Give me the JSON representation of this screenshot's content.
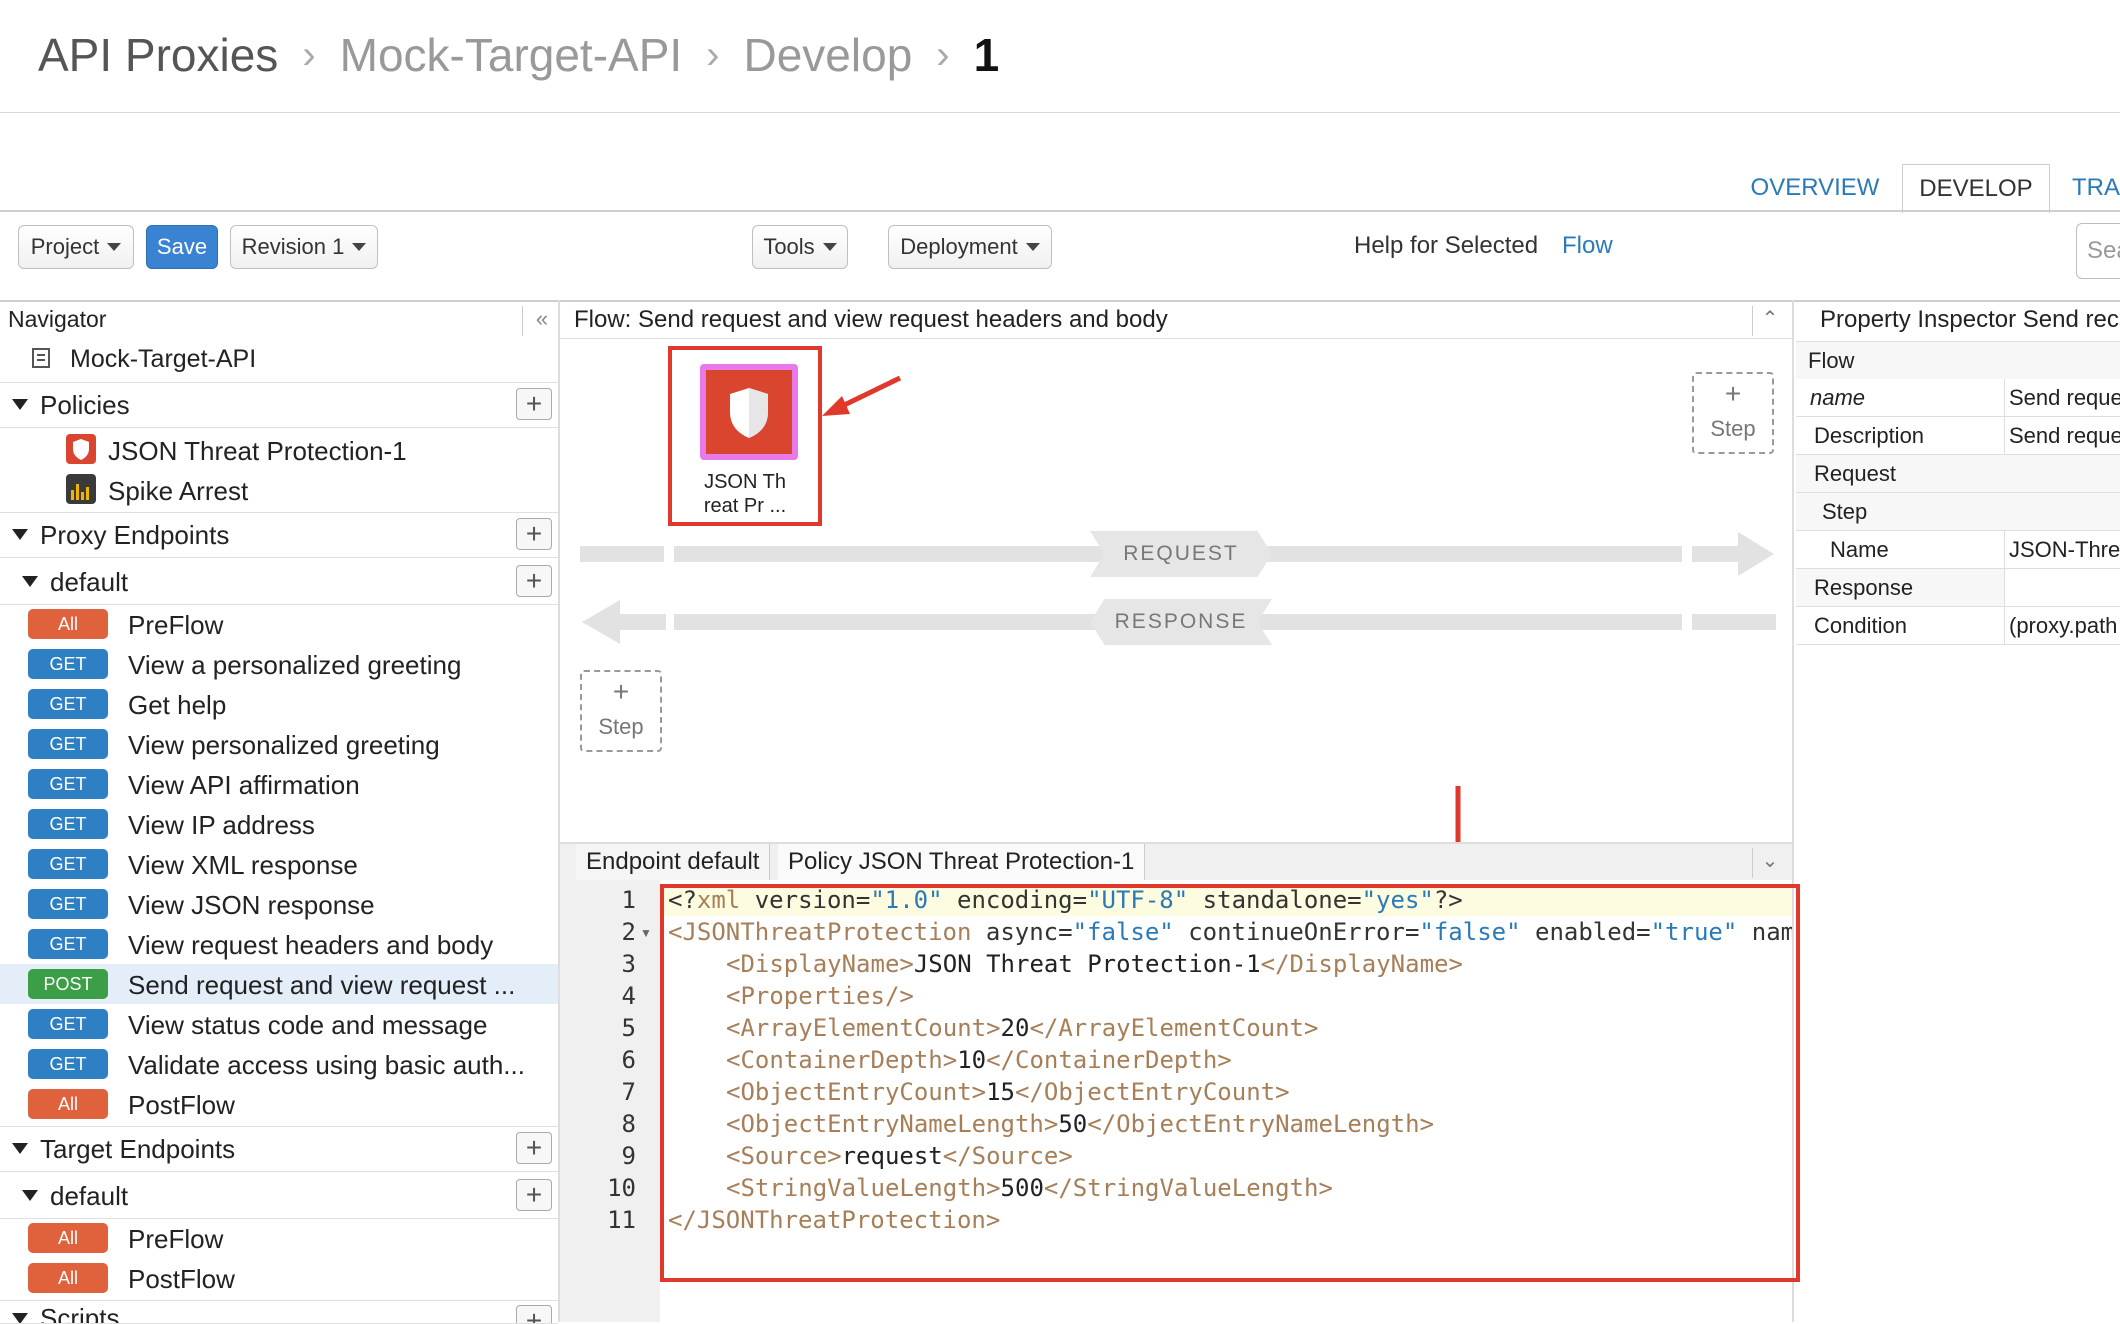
{
  "breadcrumb": {
    "items": [
      "API Proxies",
      "Mock-Target-API",
      "Develop",
      "1"
    ]
  },
  "tabs": {
    "overview": "OVERVIEW",
    "develop": "DEVELOP",
    "trace": "TRA"
  },
  "toolbar": {
    "project": "Project",
    "save": "Save",
    "revision": "Revision 1",
    "tools": "Tools",
    "deployment": "Deployment",
    "help_label": "Help for Selected",
    "help_link": "Flow",
    "search_placeholder": "Sea"
  },
  "navigator": {
    "title": "Navigator",
    "root": "Mock-Target-API",
    "policies_label": "Policies",
    "policies": [
      "JSON Threat Protection-1",
      "Spike Arrest"
    ],
    "proxy_endpoints_label": "Proxy Endpoints",
    "proxy_default_label": "default",
    "proxy_flows": [
      {
        "method": "All",
        "name": "PreFlow"
      },
      {
        "method": "GET",
        "name": "View a personalized greeting"
      },
      {
        "method": "GET",
        "name": "Get help"
      },
      {
        "method": "GET",
        "name": "View personalized greeting"
      },
      {
        "method": "GET",
        "name": "View API affirmation"
      },
      {
        "method": "GET",
        "name": "View IP address"
      },
      {
        "method": "GET",
        "name": "View XML response"
      },
      {
        "method": "GET",
        "name": "View JSON response"
      },
      {
        "method": "GET",
        "name": "View request headers and body"
      },
      {
        "method": "POST",
        "name": "Send request and view request ..."
      },
      {
        "method": "GET",
        "name": "View status code and message"
      },
      {
        "method": "GET",
        "name": "Validate access using basic auth..."
      },
      {
        "method": "All",
        "name": "PostFlow"
      }
    ],
    "target_endpoints_label": "Target Endpoints",
    "target_default_label": "default",
    "target_flows": [
      {
        "method": "All",
        "name": "PreFlow"
      },
      {
        "method": "All",
        "name": "PostFlow"
      }
    ],
    "scripts_label": "Scripts"
  },
  "flow": {
    "title": "Flow: Send request and view request headers and body",
    "policy_caption_1": "JSON Th",
    "policy_caption_2": "reat Pr ...",
    "step_plus": "+",
    "step_label": "Step",
    "request_label": "REQUEST",
    "response_label": "RESPONSE"
  },
  "editor": {
    "tab_endpoint": "Endpoint default",
    "tab_policy": "Policy JSON Threat Protection-1",
    "line_numbers": [
      "1",
      "2",
      "3",
      "4",
      "5",
      "6",
      "7",
      "8",
      "9",
      "10",
      "11"
    ],
    "xml_decl": {
      "open": "<?",
      "name": "xml",
      "version_attr": " version=",
      "version_val": "\"1.0\"",
      "encoding_attr": " encoding=",
      "encoding_val": "\"UTF-8\"",
      "standalone_attr": " standalone=",
      "standalone_val": "\"yes\"",
      "close": "?>"
    },
    "root_open": {
      "tag": "<JSONThreatProtection",
      "async_attr": " async=",
      "async_val": "\"false\"",
      "coe_attr": " continueOnError=",
      "coe_val": "\"false\"",
      "enabled_attr": " enabled=",
      "enabled_val": "\"true\"",
      "name_attr": " nam"
    },
    "elements": [
      {
        "open": "<DisplayName>",
        "value": "JSON Threat Protection-1",
        "close": "</DisplayName>"
      },
      {
        "open": "<Properties/>",
        "value": "",
        "close": ""
      },
      {
        "open": "<ArrayElementCount>",
        "value": "20",
        "close": "</ArrayElementCount>"
      },
      {
        "open": "<ContainerDepth>",
        "value": "10",
        "close": "</ContainerDepth>"
      },
      {
        "open": "<ObjectEntryCount>",
        "value": "15",
        "close": "</ObjectEntryCount>"
      },
      {
        "open": "<ObjectEntryNameLength>",
        "value": "50",
        "close": "</ObjectEntryNameLength>"
      },
      {
        "open": "<Source>",
        "value": "request",
        "close": "</Source>"
      },
      {
        "open": "<StringValueLength>",
        "value": "500",
        "close": "</StringValueLength>"
      }
    ],
    "root_close": "</JSONThreatProtection>"
  },
  "inspector": {
    "title": "Property Inspector  Send rec",
    "rows": [
      {
        "key": "Flow",
        "value": ""
      },
      {
        "key": "name",
        "value": "Send reque"
      },
      {
        "key": "Description",
        "value": "Send reque"
      },
      {
        "key": "Request",
        "value": ""
      },
      {
        "key": "Step",
        "value": ""
      },
      {
        "key": "Name",
        "value": "JSON-Thre"
      },
      {
        "key": "Response",
        "value": ""
      },
      {
        "key": "Condition",
        "value": "(proxy.path"
      }
    ]
  },
  "colors": {
    "accent": "#2a7ab8",
    "save": "#3a82d2",
    "highlight": "#e0392b",
    "all_badge": "#e0623c",
    "get_badge": "#2f7fc4",
    "post_badge": "#3c9e46"
  }
}
